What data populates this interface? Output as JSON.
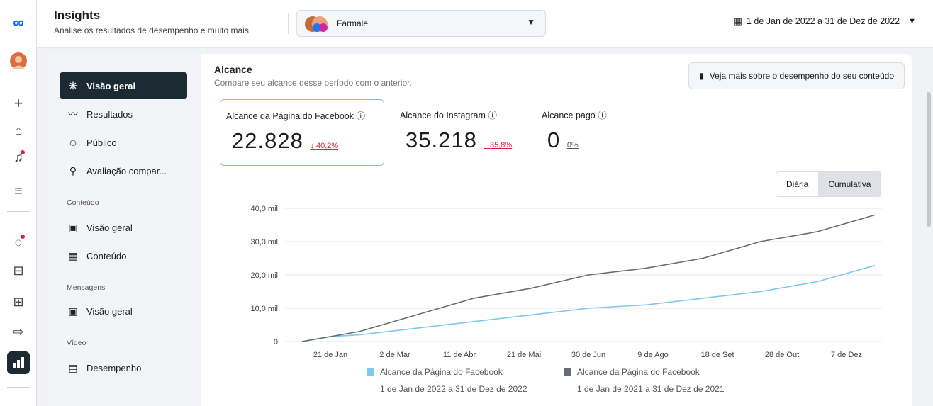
{
  "header": {
    "title": "Insights",
    "subtitle": "Analise os resultados de desempenho e muito mais.",
    "account_name": "Farmale",
    "date_range": "1 de Jan de 2022 a 31 de Dez de 2022"
  },
  "rail": [
    "meta-logo-icon",
    "profile-avatar",
    "plus-icon",
    "home-icon",
    "bell-icon",
    "menu-icon",
    "activity-icon",
    "posts-icon",
    "calendar-grid-icon",
    "megaphone-icon",
    "insights-icon"
  ],
  "sidebar": {
    "items": [
      {
        "label": "Visão geral",
        "icon": "✳",
        "selected": true
      },
      {
        "label": "Resultados",
        "icon": "〰"
      },
      {
        "label": "Público",
        "icon": "☺"
      },
      {
        "label": "Avaliação compar...",
        "icon": "⚲"
      }
    ],
    "sections": [
      {
        "title": "Conteúdo",
        "items": [
          {
            "label": "Visão geral",
            "icon": "▣"
          },
          {
            "label": "Conteúdo",
            "icon": "▦"
          }
        ]
      },
      {
        "title": "Mensagens",
        "items": [
          {
            "label": "Visão geral",
            "icon": "▣"
          }
        ]
      },
      {
        "title": "Vídeo",
        "items": [
          {
            "label": "Desempenho",
            "icon": "▤"
          }
        ]
      }
    ]
  },
  "main": {
    "title": "Alcance",
    "subtitle": "Compare seu alcance desse período com o anterior.",
    "more_button": "Veja mais sobre o desempenho do seu conteúdo",
    "metrics": [
      {
        "label": "Alcance da Página do Facebook",
        "value": "22.828",
        "change": "40,2%",
        "direction": "down"
      },
      {
        "label": "Alcance do Instagram",
        "value": "35.218",
        "change": "35,8%",
        "direction": "down"
      },
      {
        "label": "Alcance pago",
        "value": "0",
        "change": "0%",
        "direction": "none"
      }
    ],
    "toggle": {
      "options": [
        "Diária",
        "Cumulativa"
      ],
      "selected": "Cumulativa"
    }
  },
  "chart_data": {
    "type": "line",
    "y_ticks": [
      "40,0 mil",
      "30,0 mil",
      "20,0 mil",
      "10,0 mil",
      "0"
    ],
    "ylim": [
      0,
      40000
    ],
    "x_ticks": [
      "21 de Jan",
      "2 de Mar",
      "11 de Abr",
      "21 de Mai",
      "30 de Jun",
      "9 de Ago",
      "18 de Set",
      "28 de Out",
      "7 de Dez"
    ],
    "grid": true,
    "series": [
      {
        "name": "Alcance da Página do Facebook",
        "period": "1 de Jan de 2022 a 31 de Dez de 2022",
        "color": "#7ec8ef",
        "points": [
          [
            0,
            0
          ],
          [
            0.05,
            1500
          ],
          [
            0.1,
            2000
          ],
          [
            0.2,
            4000
          ],
          [
            0.3,
            6000
          ],
          [
            0.4,
            8000
          ],
          [
            0.5,
            10000
          ],
          [
            0.6,
            11000
          ],
          [
            0.7,
            13000
          ],
          [
            0.8,
            15000
          ],
          [
            0.9,
            18000
          ],
          [
            1.0,
            22828
          ]
        ]
      },
      {
        "name": "Alcance da Página do Facebook",
        "period": "1 de Jan de 2021 a 31 de Dez de 2021",
        "color": "#666d72",
        "points": [
          [
            0,
            0
          ],
          [
            0.1,
            3000
          ],
          [
            0.2,
            8000
          ],
          [
            0.3,
            13000
          ],
          [
            0.4,
            16000
          ],
          [
            0.5,
            20000
          ],
          [
            0.6,
            22000
          ],
          [
            0.7,
            25000
          ],
          [
            0.8,
            30000
          ],
          [
            0.9,
            33000
          ],
          [
            1.0,
            38000
          ]
        ]
      }
    ]
  },
  "colors": {
    "accent": "#1c2b33",
    "fb_series": "#7ec8ef",
    "prev_series": "#666d72",
    "down": "#e41e3f"
  }
}
